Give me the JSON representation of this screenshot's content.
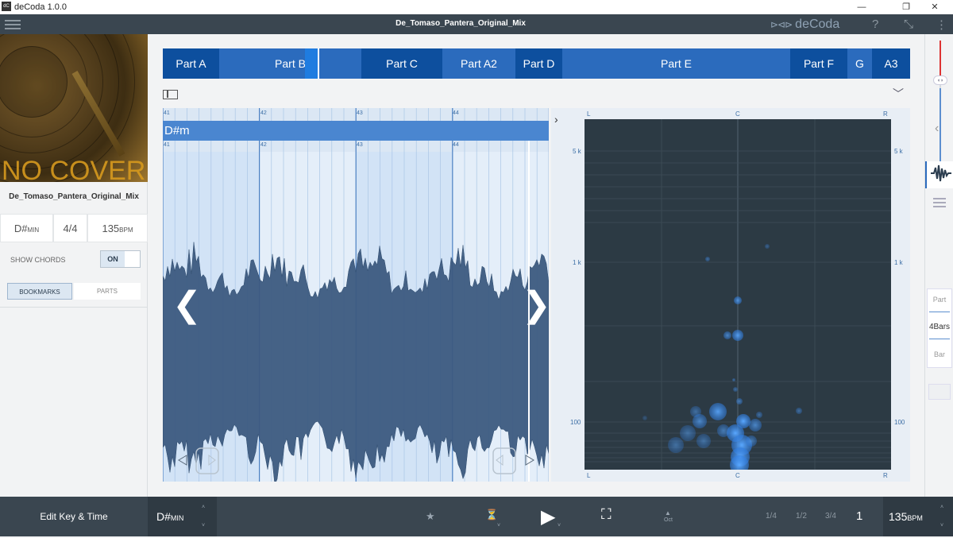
{
  "window": {
    "app_title": "deCoda 1.0.0",
    "minimize": "—",
    "restore": "❐",
    "close": "✕"
  },
  "header": {
    "filename": "De_Tomaso_Pantera_Original_Mix",
    "logo_text": "deCoda",
    "logo_mark": "⊳⊲⊳",
    "help": "?",
    "fullscreen": "⤡",
    "more": "⋮"
  },
  "left": {
    "cover_text": "NO COVER",
    "track_name": "De_Tomaso_Pantera_Original_Mix",
    "key_value": "D#",
    "key_mode": "MIN",
    "time_signature": "4/4",
    "tempo_value": "135",
    "tempo_unit": "BPM",
    "show_chords_label": "SHOW CHORDS",
    "show_chords_state": "ON",
    "tabs": [
      "BOOKMARKS",
      "PARTS"
    ]
  },
  "parts": [
    {
      "label": "Part A",
      "dark": true
    },
    {
      "label": "Part B",
      "dark": false
    },
    {
      "label": "Part C",
      "dark": true
    },
    {
      "label": "Part A2",
      "dark": false
    },
    {
      "label": "Part D",
      "dark": true
    },
    {
      "label": "Part E",
      "dark": false
    },
    {
      "label": "Part F",
      "dark": true
    },
    {
      "label": "G",
      "dark": false
    },
    {
      "label": "A3",
      "dark": true
    }
  ],
  "waveform": {
    "bar_numbers": [
      "41",
      "42",
      "43",
      "44"
    ],
    "chord": "D#m",
    "prev_arrow": "❮",
    "next_arrow": "❯"
  },
  "spectrum": {
    "top_labels": [
      "L",
      "C",
      "R"
    ],
    "bottom_labels": [
      "L",
      "C",
      "R"
    ],
    "freq_labels": [
      "5 k",
      "1 k",
      "100"
    ],
    "expand": "›"
  },
  "rightbar": {
    "collapse": "‹",
    "view_options": [
      "Part",
      "4Bars",
      "Bar"
    ],
    "selected_view": "4Bars"
  },
  "transport": {
    "edit_key_time": "Edit Key & Time",
    "key_value": "D#",
    "key_mode": "MIN",
    "star": "★",
    "metronome": "⏳",
    "play": "▶",
    "loop": "⛶",
    "octave_up": "▲",
    "octave_label": "Oct",
    "beats": [
      "1/4",
      "1/2",
      "3/4"
    ],
    "current_beat": "1",
    "tempo_value": "135",
    "tempo_unit": "BPM",
    "arrow_up": "˄",
    "arrow_down": "˅"
  },
  "colors": {
    "accent": "#2b6bbd",
    "accent_dark": "#0d4f9e",
    "header_bg": "#3a4650",
    "spectrum_bg": "#2c3a44",
    "wave_fill": "#3c5a80",
    "blob": "#3d8fe8"
  }
}
